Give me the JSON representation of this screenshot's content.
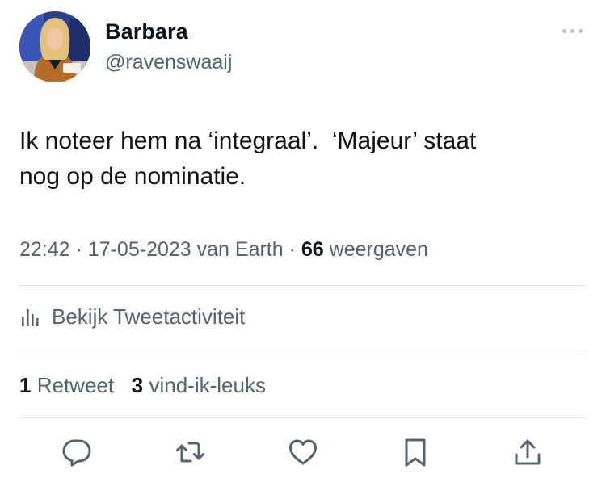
{
  "author": {
    "display_name": "Barbara",
    "handle": "@ravenswaaij"
  },
  "tweet": {
    "text": "Ik noteer hem na ‘integraal’.  ‘Majeur’ staat\nnog op de nominatie.",
    "time": "22:42",
    "separator": "·",
    "date": "17-05-2023",
    "source": "van Earth",
    "views_count": "66",
    "views_label": "weergaven"
  },
  "activity": {
    "label": "Bekijk Tweetactiviteit"
  },
  "stats": {
    "retweets_count": "1",
    "retweets_label": "Retweet",
    "likes_count": "3",
    "likes_label": "vind-ik-leuks"
  },
  "icons": {
    "more": "more-horizontal-icon",
    "activity": "bar-chart-icon",
    "reply": "reply-icon",
    "retweet": "retweet-icon",
    "like": "heart-icon",
    "bookmark": "bookmark-icon",
    "share": "share-icon"
  },
  "colors": {
    "text_primary": "#0f1419",
    "text_secondary": "#536471",
    "divider": "#e3e7ea"
  }
}
